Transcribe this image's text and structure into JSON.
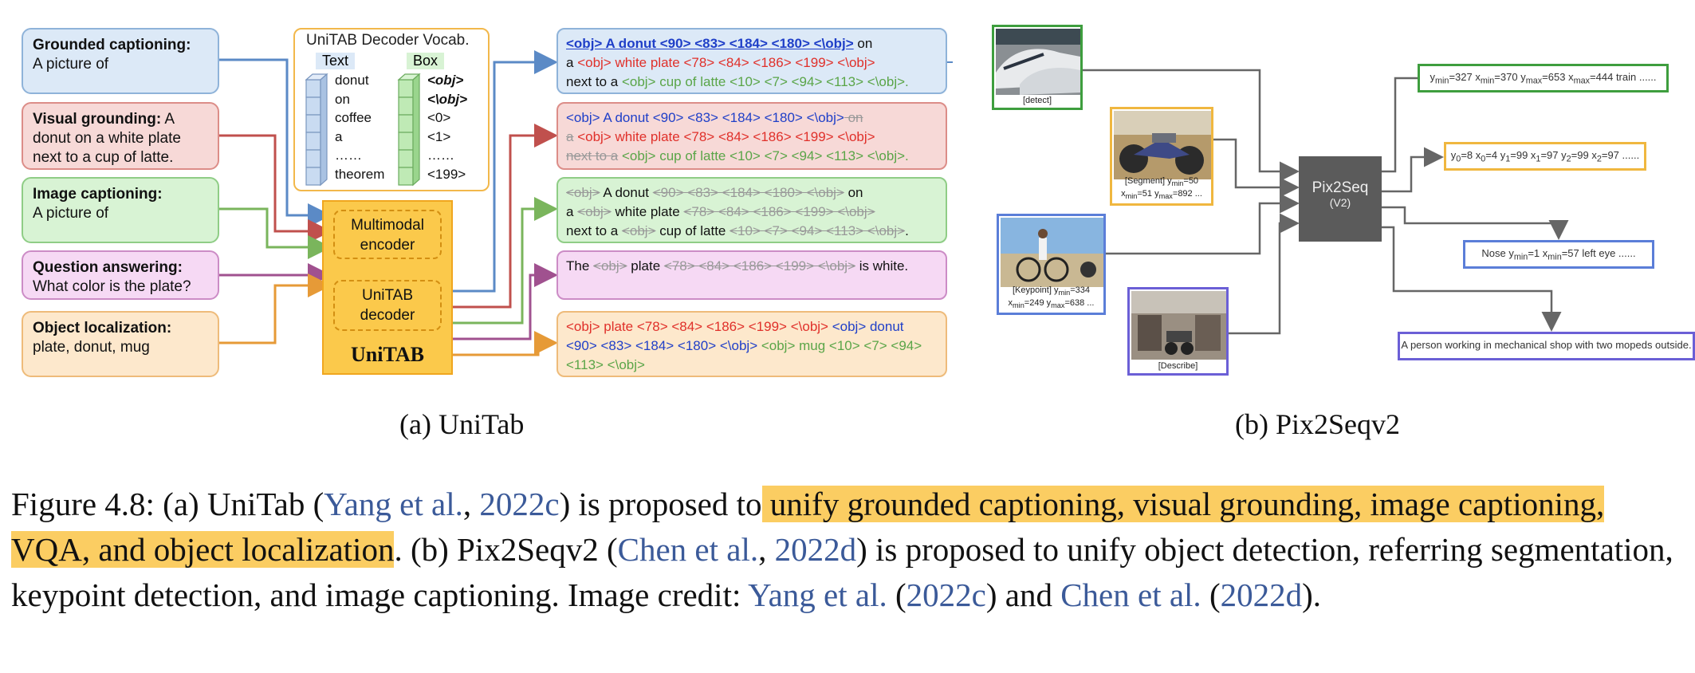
{
  "left_tasks": [
    {
      "label": "Grounded captioning:",
      "text": "A picture of"
    },
    {
      "label": "Visual grounding:",
      "text": " A donut on a white plate next to a cup of latte."
    },
    {
      "label": "Image captioning:",
      "text": "A picture of"
    },
    {
      "label": "Question answering:",
      "text": "What color is the plate?"
    },
    {
      "label": "Object localization:",
      "text": "plate, donut, mug"
    }
  ],
  "vocab": {
    "title": "UniTAB Decoder Vocab.",
    "text_header": "Text",
    "box_header": "Box",
    "text_items": [
      "donut",
      "on",
      "coffee",
      "a",
      "……",
      "theorem"
    ],
    "box_items": [
      "<obj>",
      "<\\obj>",
      "<0>",
      "<1>",
      "……",
      "<199>"
    ]
  },
  "unitab": {
    "encoder": "Multimodal encoder",
    "decoder": "UniTAB decoder",
    "name": "UniTAB"
  },
  "outputs": {
    "o1": {
      "a": "<obj> A donut <90> <83> <184> <180> <\\obj>",
      "b": " on",
      "c": "a ",
      "d": "<obj> white plate <78> <84> <186> <199> <\\obj>",
      "e": "next to a ",
      "f": "<obj> cup of latte <10> <7> <94> <113> <\\obj>."
    },
    "o2": {
      "a": "<obj> A donut <90> <83> <184> <180> <\\obj>",
      "b": " on",
      "c": "a",
      "d": " <obj> white plate <78> <84> <186> <199> <\\obj>",
      "e": "next to a",
      "f": " <obj> cup of latte <10> <7> <94> <113> <\\obj>."
    },
    "o3": {
      "a": "<obj>",
      "b": " A donut ",
      "c": "<90> <83> <184> <180> <\\obj>",
      "d": " on",
      "e": "a ",
      "f": "<obj>",
      "g": " white plate ",
      "h": "<78> <84> <186> <199> <\\obj>",
      "i": "next to a ",
      "j": "<obj>",
      "k": " cup of latte ",
      "l": "<10> <7> <94> <113> <\\obj>",
      "m": "."
    },
    "o4": {
      "a": "The ",
      "b": "<obj>",
      "c": " plate ",
      "d": "<78> <84> <186> <199> <\\obj>",
      "e": " is white."
    },
    "o5": {
      "a": "<obj> plate <78> <84> <186> <199> <\\obj>",
      "b": " <obj> donut <90> <83> <184> <180> <\\obj>",
      "c": " <obj> mug <10> <7> <94> <113> <\\obj>"
    }
  },
  "pix2seq": {
    "title": "Pix2Seq",
    "version": "(V2)",
    "thumbs": {
      "detect": "[detect]",
      "segment_1": "[Segment] y",
      "segment_2": "=50",
      "segment_3": "x",
      "segment_4": "=51  y",
      "segment_5": "=892 ...",
      "keypoint_1": "[Keypoint] y",
      "keypoint_2": "=334",
      "keypoint_3": "x",
      "keypoint_4": "=249 y",
      "keypoint_5": "=638 ...",
      "describe": "[Describe]"
    },
    "results": {
      "r1": "y<sub>min</sub>=327 x<sub>min</sub>=370 y<sub>max</sub>=653 x<sub>max</sub>=444 train ......",
      "r2": "y<sub>0</sub>=8 x<sub>0</sub>=4 y<sub>1</sub>=99 x<sub>1</sub>=97 y<sub>2</sub>=99 x<sub>2</sub>=97 ......",
      "r3": "Nose y<sub>min</sub>=1 x<sub>min</sub>=57 left eye ......",
      "r4": "A person working in mechanical shop with two mopeds outside."
    },
    "sub_min": "min",
    "sub_max": "max"
  },
  "subcaptions": {
    "a": "(a) UniTab",
    "b": "(b) Pix2Seqv2"
  },
  "figure": {
    "p1": "Figure 4.8: (a) UniTab (",
    "ref1": "Yang et al.",
    "p2": ", ",
    "ref2": "2022c",
    "p3": ") is proposed to",
    "hl": " unify grounded captioning, visual grounding, image captioning, VQA, and object localization",
    "p4": ". (b) Pix2Seqv2 (",
    "ref3": "Chen et al.",
    "p5": ", ",
    "ref4": "2022d",
    "p6": ") is proposed to unify object detection, referring segmentation, keypoint detection, and image captioning. Image credit: ",
    "ref5": "Yang et al.",
    "p7": " (",
    "ref6": "2022c",
    "p8": ") and ",
    "ref7": "Chen et al.",
    "p9": " (",
    "ref8": "2022d",
    "p10": ")."
  },
  "colors": {
    "blue": "#5b8ac6",
    "red": "#c0504d",
    "green": "#7ab55c",
    "pink": "#a0518f",
    "orange": "#e69a37",
    "connector": "#666666"
  }
}
